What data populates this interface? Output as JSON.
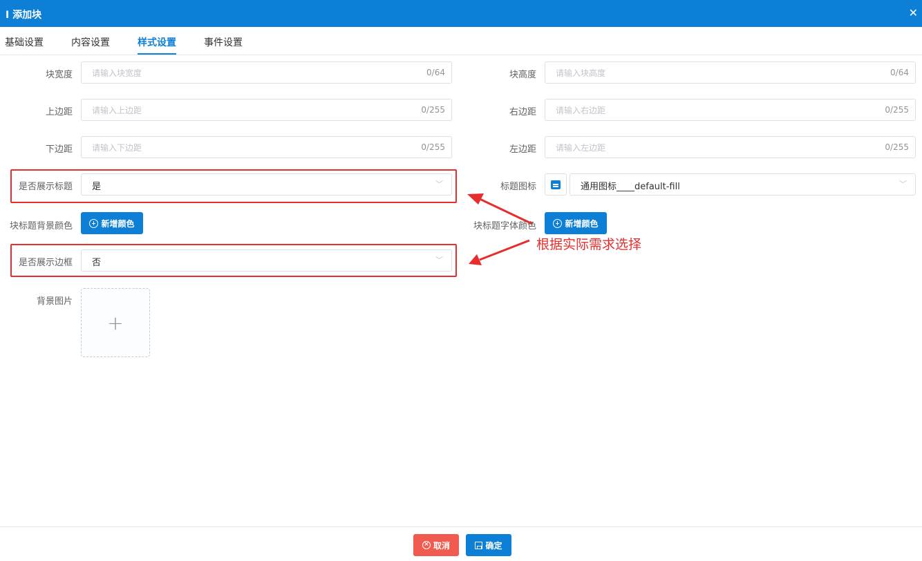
{
  "dialog": {
    "title": "添加块",
    "close_icon": "✕"
  },
  "tabs": [
    {
      "label": "基础设置"
    },
    {
      "label": "内容设置"
    },
    {
      "label": "样式设置"
    },
    {
      "label": "事件设置"
    }
  ],
  "form": {
    "block_width": {
      "label": "块宽度",
      "placeholder": "请输入块宽度",
      "count": "0/64"
    },
    "block_height": {
      "label": "块高度",
      "placeholder": "请输入块高度",
      "count": "0/64"
    },
    "margin_top": {
      "label": "上边距",
      "placeholder": "请输入上边距",
      "count": "0/255"
    },
    "margin_right": {
      "label": "右边距",
      "placeholder": "请输入右边距",
      "count": "0/255"
    },
    "margin_bottom": {
      "label": "下边距",
      "placeholder": "请输入下边距",
      "count": "0/255"
    },
    "margin_left": {
      "label": "左边距",
      "placeholder": "请输入左边距",
      "count": "0/255"
    },
    "show_title": {
      "label": "是否展示标题",
      "value": "是"
    },
    "title_icon": {
      "label": "标题图标",
      "value": "通用图标____default-fill"
    },
    "title_bg_color": {
      "label": "块标题背景颜色",
      "button": "新增颜色"
    },
    "title_font_color": {
      "label": "块标题字体颜色",
      "button": "新增颜色"
    },
    "show_border": {
      "label": "是否展示边框",
      "value": "否"
    },
    "bg_image": {
      "label": "背景图片"
    }
  },
  "annotation": {
    "text": "根据实际需求选择",
    "color": "#e62e2e"
  },
  "footer": {
    "cancel": "取消",
    "confirm": "确定"
  },
  "colors": {
    "primary": "#0d7fd6",
    "danger": "#f05a4f"
  }
}
